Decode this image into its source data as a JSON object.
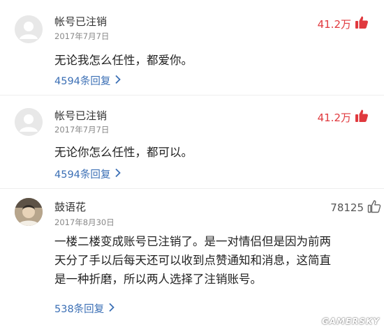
{
  "comments": [
    {
      "username": "帐号已注销",
      "date": "2017年7月7日",
      "likes": "41.2万",
      "likes_color": "#e0393e",
      "text": "无论我怎么任性，都爱你。",
      "replies": "4594条回复",
      "avatar_icon": "default-avatar-icon",
      "like_icon": "thumbs-up-filled-icon"
    },
    {
      "username": "帐号已注销",
      "date": "2017年7月7日",
      "likes": "41.2万",
      "likes_color": "#e0393e",
      "text": "无论你怎么任性，都可以。",
      "replies": "4594条回复",
      "avatar_icon": "default-avatar-icon",
      "like_icon": "thumbs-up-filled-icon"
    },
    {
      "username": "鼓语花",
      "date": "2017年8月30日",
      "likes": "78125",
      "likes_color": "#555555",
      "text_lines": [
        "一楼二楼变成账号已注销了。是一对情侣但是因为前两",
        "天分了手以后每天还可以收到点赞通知和消息，这简直",
        "是一种折磨，所以两人选择了注销账号。"
      ],
      "replies": "538条回复",
      "avatar_icon": "user-photo-avatar",
      "like_icon": "thumbs-up-outline-icon"
    }
  ],
  "watermark": "GAMERSKY"
}
